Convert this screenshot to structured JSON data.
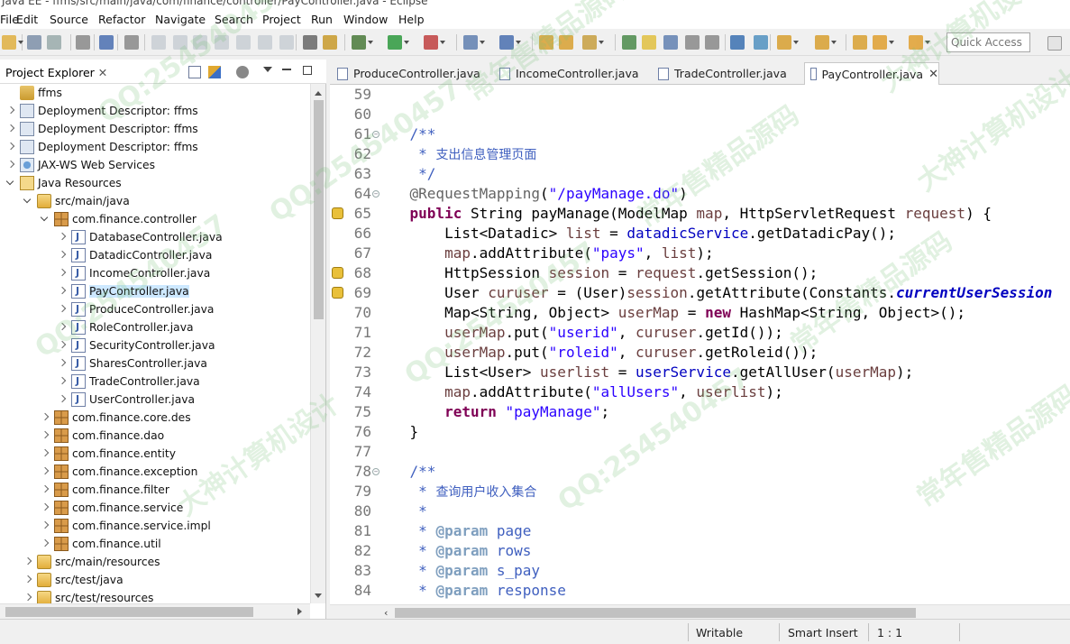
{
  "window": {
    "title": "Java EE - ffms/src/main/java/com/finance/controller/PayController.java - Eclipse"
  },
  "menubar": [
    "File",
    "Edit",
    "Source",
    "Refactor",
    "Navigate",
    "Search",
    "Project",
    "Run",
    "Window",
    "Help"
  ],
  "toolbar": {
    "quick_access_placeholder": "Quick Access"
  },
  "explorer": {
    "title": "Project Explorer",
    "tree": [
      {
        "label": "ffms",
        "icon": "project-icon",
        "depth": 0,
        "state": "none"
      },
      {
        "label": "Deployment Descriptor: ffms",
        "icon": "deployment-descriptor-icon",
        "depth": 0,
        "state": "collapsed"
      },
      {
        "label": "Deployment Descriptor: ffms",
        "icon": "deployment-descriptor-icon",
        "depth": 0,
        "state": "collapsed"
      },
      {
        "label": "Deployment Descriptor: ffms",
        "icon": "deployment-descriptor-icon",
        "depth": 0,
        "state": "collapsed"
      },
      {
        "label": "JAX-WS Web Services",
        "icon": "web-services-icon",
        "depth": 0,
        "state": "collapsed"
      },
      {
        "label": "Java Resources",
        "icon": "java-resources-icon",
        "depth": 0,
        "state": "expanded"
      },
      {
        "label": "src/main/java",
        "icon": "source-folder-icon",
        "depth": 1,
        "state": "expanded"
      },
      {
        "label": "com.finance.controller",
        "icon": "package-icon",
        "depth": 2,
        "state": "expanded"
      },
      {
        "label": "DatabaseController.java",
        "icon": "java-file-icon",
        "depth": 3,
        "state": "collapsed"
      },
      {
        "label": "DatadicController.java",
        "icon": "java-file-icon",
        "depth": 3,
        "state": "collapsed"
      },
      {
        "label": "IncomeController.java",
        "icon": "java-file-icon",
        "depth": 3,
        "state": "collapsed"
      },
      {
        "label": "PayController.java",
        "icon": "java-file-icon",
        "depth": 3,
        "state": "collapsed",
        "selected": true
      },
      {
        "label": "ProduceController.java",
        "icon": "java-file-icon",
        "depth": 3,
        "state": "collapsed"
      },
      {
        "label": "RoleController.java",
        "icon": "java-file-icon",
        "depth": 3,
        "state": "collapsed"
      },
      {
        "label": "SecurityController.java",
        "icon": "java-file-icon",
        "depth": 3,
        "state": "collapsed"
      },
      {
        "label": "SharesController.java",
        "icon": "java-file-icon",
        "depth": 3,
        "state": "collapsed"
      },
      {
        "label": "TradeController.java",
        "icon": "java-file-icon",
        "depth": 3,
        "state": "collapsed"
      },
      {
        "label": "UserController.java",
        "icon": "java-file-icon",
        "depth": 3,
        "state": "collapsed"
      },
      {
        "label": "com.finance.core.des",
        "icon": "package-icon",
        "depth": 2,
        "state": "collapsed"
      },
      {
        "label": "com.finance.dao",
        "icon": "package-icon",
        "depth": 2,
        "state": "collapsed"
      },
      {
        "label": "com.finance.entity",
        "icon": "package-icon",
        "depth": 2,
        "state": "collapsed"
      },
      {
        "label": "com.finance.exception",
        "icon": "package-icon",
        "depth": 2,
        "state": "collapsed"
      },
      {
        "label": "com.finance.filter",
        "icon": "package-icon",
        "depth": 2,
        "state": "collapsed"
      },
      {
        "label": "com.finance.service",
        "icon": "package-icon",
        "depth": 2,
        "state": "collapsed"
      },
      {
        "label": "com.finance.service.impl",
        "icon": "package-icon",
        "depth": 2,
        "state": "collapsed"
      },
      {
        "label": "com.finance.util",
        "icon": "package-icon",
        "depth": 2,
        "state": "collapsed"
      },
      {
        "label": "src/main/resources",
        "icon": "source-folder-icon",
        "depth": 1,
        "state": "collapsed"
      },
      {
        "label": "src/test/java",
        "icon": "source-folder-icon",
        "depth": 1,
        "state": "collapsed"
      },
      {
        "label": "src/test/resources",
        "icon": "source-folder-icon",
        "depth": 1,
        "state": "collapsed"
      }
    ]
  },
  "editor": {
    "tabs": [
      {
        "label": "ProduceController.java",
        "active": false
      },
      {
        "label": "IncomeController.java",
        "active": false
      },
      {
        "label": "TradeController.java",
        "active": false
      },
      {
        "label": "PayController.java",
        "active": true
      }
    ],
    "close_glyph": "✕",
    "lines": [
      {
        "n": "59",
        "segs": []
      },
      {
        "n": "60",
        "segs": []
      },
      {
        "n": "61",
        "fold": true,
        "segs": [
          {
            "c": "cm",
            "t": "    /**"
          }
        ]
      },
      {
        "n": "62",
        "segs": [
          {
            "c": "cm",
            "t": "     * "
          },
          {
            "c": "cmtxt",
            "t": "支出信息管理页面"
          }
        ]
      },
      {
        "n": "63",
        "segs": [
          {
            "c": "cm",
            "t": "     */"
          }
        ]
      },
      {
        "n": "64",
        "fold": true,
        "segs": [
          {
            "c": "ann",
            "t": "    @RequestMapping"
          },
          {
            "c": "cn",
            "t": "("
          },
          {
            "c": "str",
            "t": "\"/payManage.do\""
          },
          {
            "c": "cn",
            "t": ")"
          }
        ]
      },
      {
        "n": "65",
        "marker": true,
        "segs": [
          {
            "c": "kw",
            "t": "    public"
          },
          {
            "c": "cn",
            "t": " String payManage(ModelMap "
          },
          {
            "c": "vr",
            "t": "map"
          },
          {
            "c": "cn",
            "t": ", HttpServletRequest "
          },
          {
            "c": "vr",
            "t": "request"
          },
          {
            "c": "cn",
            "t": ") {"
          }
        ]
      },
      {
        "n": "66",
        "segs": [
          {
            "c": "cn",
            "t": "        List<Datadic> "
          },
          {
            "c": "vr",
            "t": "list"
          },
          {
            "c": "cn",
            "t": " = "
          },
          {
            "c": "fld",
            "t": "datadicService"
          },
          {
            "c": "cn",
            "t": ".getDatadicPay();"
          }
        ]
      },
      {
        "n": "67",
        "segs": [
          {
            "c": "vr",
            "t": "        map"
          },
          {
            "c": "cn",
            "t": ".addAttribute("
          },
          {
            "c": "str",
            "t": "\"pays\""
          },
          {
            "c": "cn",
            "t": ", "
          },
          {
            "c": "vr",
            "t": "list"
          },
          {
            "c": "cn",
            "t": ");"
          }
        ]
      },
      {
        "n": "68",
        "marker": true,
        "segs": [
          {
            "c": "cn",
            "t": "        HttpSession "
          },
          {
            "c": "vr",
            "t": "session"
          },
          {
            "c": "cn",
            "t": " = "
          },
          {
            "c": "vr",
            "t": "request"
          },
          {
            "c": "cn",
            "t": ".getSession();"
          }
        ]
      },
      {
        "n": "69",
        "marker": true,
        "segs": [
          {
            "c": "cn",
            "t": "        User "
          },
          {
            "c": "vr",
            "t": "curuser"
          },
          {
            "c": "cn",
            "t": " = (User)"
          },
          {
            "c": "vr",
            "t": "session"
          },
          {
            "c": "cn",
            "t": ".getAttribute(Constants."
          },
          {
            "c": "sfld",
            "t": "currentUserSession"
          }
        ]
      },
      {
        "n": "70",
        "segs": [
          {
            "c": "cn",
            "t": "        Map<String, Object> "
          },
          {
            "c": "vr",
            "t": "userMap"
          },
          {
            "c": "cn",
            "t": " = "
          },
          {
            "c": "kw",
            "t": "new"
          },
          {
            "c": "cn",
            "t": " HashMap<String, Object>();"
          }
        ]
      },
      {
        "n": "71",
        "segs": [
          {
            "c": "vr",
            "t": "        userMap"
          },
          {
            "c": "cn",
            "t": ".put("
          },
          {
            "c": "str",
            "t": "\"userid\""
          },
          {
            "c": "cn",
            "t": ", "
          },
          {
            "c": "vr",
            "t": "curuser"
          },
          {
            "c": "cn",
            "t": ".getId());"
          }
        ]
      },
      {
        "n": "72",
        "segs": [
          {
            "c": "vr",
            "t": "        userMap"
          },
          {
            "c": "cn",
            "t": ".put("
          },
          {
            "c": "str",
            "t": "\"roleid\""
          },
          {
            "c": "cn",
            "t": ", "
          },
          {
            "c": "vr",
            "t": "curuser"
          },
          {
            "c": "cn",
            "t": ".getRoleid());"
          }
        ]
      },
      {
        "n": "73",
        "segs": [
          {
            "c": "cn",
            "t": "        List<User> "
          },
          {
            "c": "vr",
            "t": "userlist"
          },
          {
            "c": "cn",
            "t": " = "
          },
          {
            "c": "fld",
            "t": "userService"
          },
          {
            "c": "cn",
            "t": ".getAllUser("
          },
          {
            "c": "vr",
            "t": "userMap"
          },
          {
            "c": "cn",
            "t": ");"
          }
        ]
      },
      {
        "n": "74",
        "segs": [
          {
            "c": "vr",
            "t": "        map"
          },
          {
            "c": "cn",
            "t": ".addAttribute("
          },
          {
            "c": "str",
            "t": "\"allUsers\""
          },
          {
            "c": "cn",
            "t": ", "
          },
          {
            "c": "vr",
            "t": "userlist"
          },
          {
            "c": "cn",
            "t": ");"
          }
        ]
      },
      {
        "n": "75",
        "segs": [
          {
            "c": "kw",
            "t": "        return"
          },
          {
            "c": "cn",
            "t": " "
          },
          {
            "c": "str",
            "t": "\"payManage\""
          },
          {
            "c": "cn",
            "t": ";"
          }
        ]
      },
      {
        "n": "76",
        "segs": [
          {
            "c": "cn",
            "t": "    }"
          }
        ]
      },
      {
        "n": "77",
        "segs": []
      },
      {
        "n": "78",
        "fold": true,
        "segs": [
          {
            "c": "cm",
            "t": "    /**"
          }
        ]
      },
      {
        "n": "79",
        "segs": [
          {
            "c": "cm",
            "t": "     * "
          },
          {
            "c": "cmtxt",
            "t": "查询用户收入集合"
          }
        ]
      },
      {
        "n": "80",
        "segs": [
          {
            "c": "cm",
            "t": "     *"
          }
        ]
      },
      {
        "n": "81",
        "segs": [
          {
            "c": "cm",
            "t": "     * "
          },
          {
            "c": "tag",
            "t": "@param"
          },
          {
            "c": "cm",
            "t": " page"
          }
        ]
      },
      {
        "n": "82",
        "segs": [
          {
            "c": "cm",
            "t": "     * "
          },
          {
            "c": "tag",
            "t": "@param"
          },
          {
            "c": "cm",
            "t": " rows"
          }
        ]
      },
      {
        "n": "83",
        "segs": [
          {
            "c": "cm",
            "t": "     * "
          },
          {
            "c": "tag",
            "t": "@param"
          },
          {
            "c": "cm",
            "t": " s_pay"
          }
        ]
      },
      {
        "n": "84",
        "segs": [
          {
            "c": "cm",
            "t": "     * "
          },
          {
            "c": "tag",
            "t": "@param"
          },
          {
            "c": "cm",
            "t": " response"
          }
        ]
      }
    ]
  },
  "statusbar": {
    "mode": "Writable",
    "insert": "Smart Insert",
    "position": "1 : 1"
  },
  "watermarks": [
    "QQ:254540457",
    "常年售精品源码",
    "大神计算机设计",
    "QQ:254540457",
    "常年售精品源码",
    "大神计算机设计",
    "QQ:254540457",
    "QQ:254540457",
    "常年售精品源码",
    "大神计算机设计",
    "QQ:254540457",
    "常年售精品源码"
  ]
}
